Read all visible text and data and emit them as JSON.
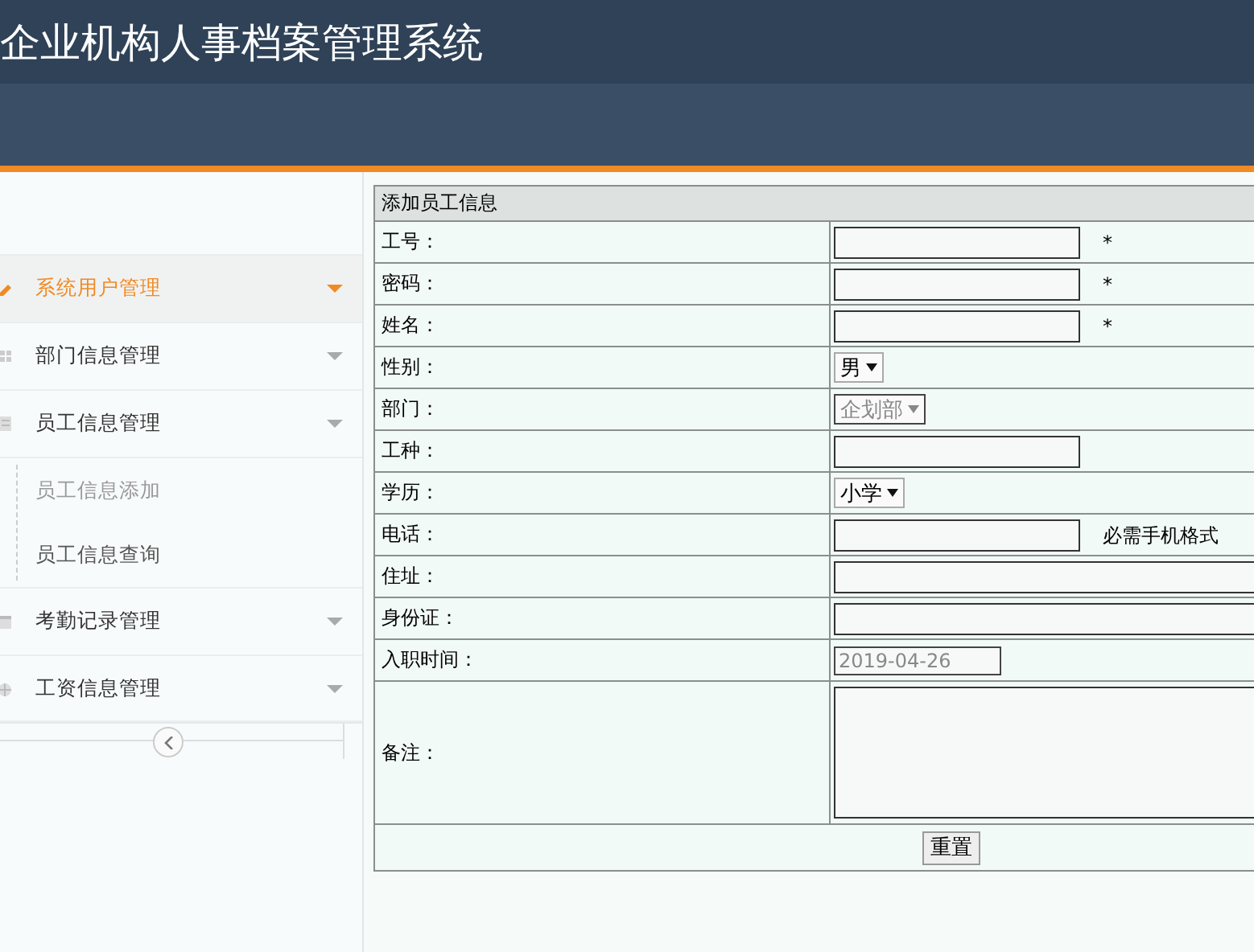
{
  "app_title": "企业机构人事档案管理系统",
  "sidebar": {
    "items": [
      {
        "label": "系统用户管理",
        "selected": true
      },
      {
        "label": "部门信息管理",
        "selected": false
      },
      {
        "label": "员工信息管理",
        "selected": false,
        "children": [
          {
            "label": "员工信息添加",
            "selected": true
          },
          {
            "label": "员工信息查询",
            "selected": false
          }
        ]
      },
      {
        "label": "考勤记录管理",
        "selected": false
      },
      {
        "label": "工资信息管理",
        "selected": false
      }
    ]
  },
  "form": {
    "title": "添加员工信息",
    "rows": [
      {
        "label": "工号：",
        "kind": "text",
        "note": "*"
      },
      {
        "label": "密码：",
        "kind": "text",
        "note": "*"
      },
      {
        "label": "姓名：",
        "kind": "text",
        "note": "*"
      },
      {
        "label": "性别：",
        "kind": "select",
        "value": "男",
        "disabled": false
      },
      {
        "label": "部门：",
        "kind": "select",
        "value": "企划部",
        "disabled": true
      },
      {
        "label": "工种：",
        "kind": "text"
      },
      {
        "label": "学历：",
        "kind": "select",
        "value": "小学",
        "disabled": false
      },
      {
        "label": "电话：",
        "kind": "text",
        "note": "必需手机格式"
      },
      {
        "label": "住址：",
        "kind": "longtext"
      },
      {
        "label": "身份证：",
        "kind": "longtext"
      },
      {
        "label": "入职时间：",
        "kind": "date",
        "value": "2019-04-26",
        "disabled": true
      },
      {
        "label": "备注：",
        "kind": "textarea"
      }
    ],
    "buttons": [
      "重置"
    ]
  }
}
